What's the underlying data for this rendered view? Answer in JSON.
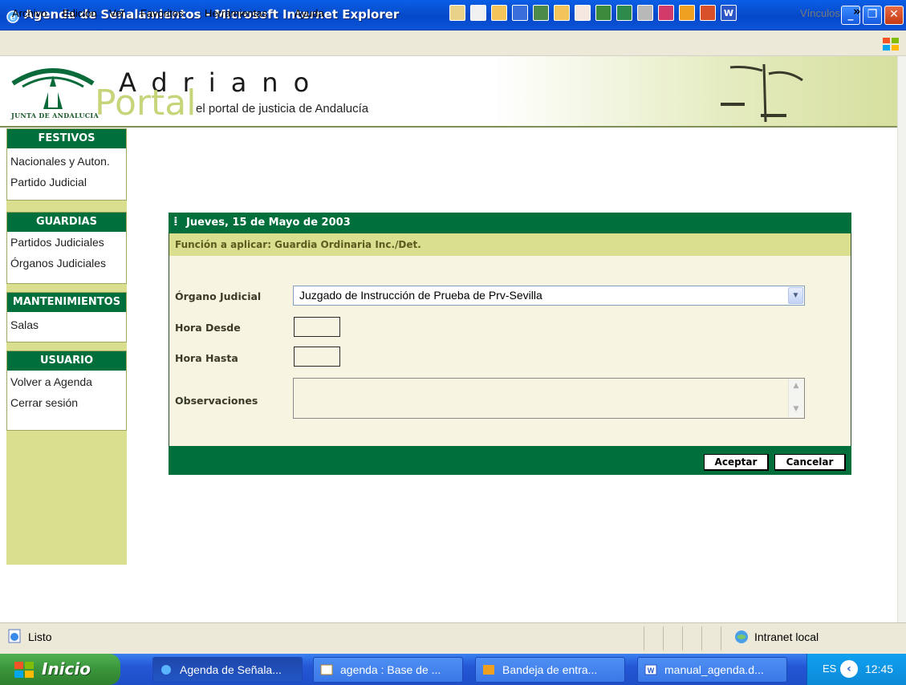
{
  "window": {
    "title": "Agenda de Señalamientos - Microsoft Internet Explorer"
  },
  "menu": {
    "items": [
      "Archivo",
      "Edición",
      "Ver",
      "Favoritos",
      "Herramientas",
      "Ayuda"
    ],
    "links_label": "Vínculos"
  },
  "banner": {
    "brand": "Adriano",
    "portal": "Portal",
    "subtitle": "el portal de justicia de Andalucía",
    "logo_text": "JUNTA DE ANDALUCIA"
  },
  "sidebar": {
    "sections": [
      {
        "title": "FESTIVOS",
        "links": [
          "Nacionales y Auton.",
          "Partido Judicial"
        ]
      },
      {
        "title": "GUARDIAS",
        "links": [
          "Partidos Judiciales",
          "Órganos Judiciales"
        ]
      },
      {
        "title": "MANTENIMIENTOS",
        "links": [
          "Salas"
        ]
      },
      {
        "title": "USUARIO",
        "links": [
          "Volver a Agenda",
          "Cerrar sesión"
        ]
      }
    ]
  },
  "dialog": {
    "date": "Jueves, 15 de Mayo de 2003",
    "function_label": "Función a aplicar: Guardia Ordinaria Inc./Det.",
    "organo_label": "Órgano Judicial",
    "organo_value": "Juzgado de Instrucción de Prueba de Prv-Sevilla",
    "hora_desde_label": "Hora Desde",
    "hora_desde_value": "",
    "hora_hasta_label": "Hora Hasta",
    "hora_hasta_value": "",
    "observaciones_label": "Observaciones",
    "observaciones_value": "",
    "accept": "Aceptar",
    "cancel": "Cancelar"
  },
  "status": {
    "text": "Listo",
    "zone": "Intranet local"
  },
  "taskbar": {
    "start": "Inicio",
    "tasks": [
      "Agenda de Señala...",
      "agenda : Base de ...",
      "Bandeja de entra...",
      "manual_agenda.d..."
    ],
    "lang": "ES",
    "clock": "12:45"
  },
  "colors": {
    "title_bar": "#0548c8",
    "green": "#006f3c",
    "olive_light": "#d9df8f",
    "dialog_bg": "#f7f4e1"
  }
}
